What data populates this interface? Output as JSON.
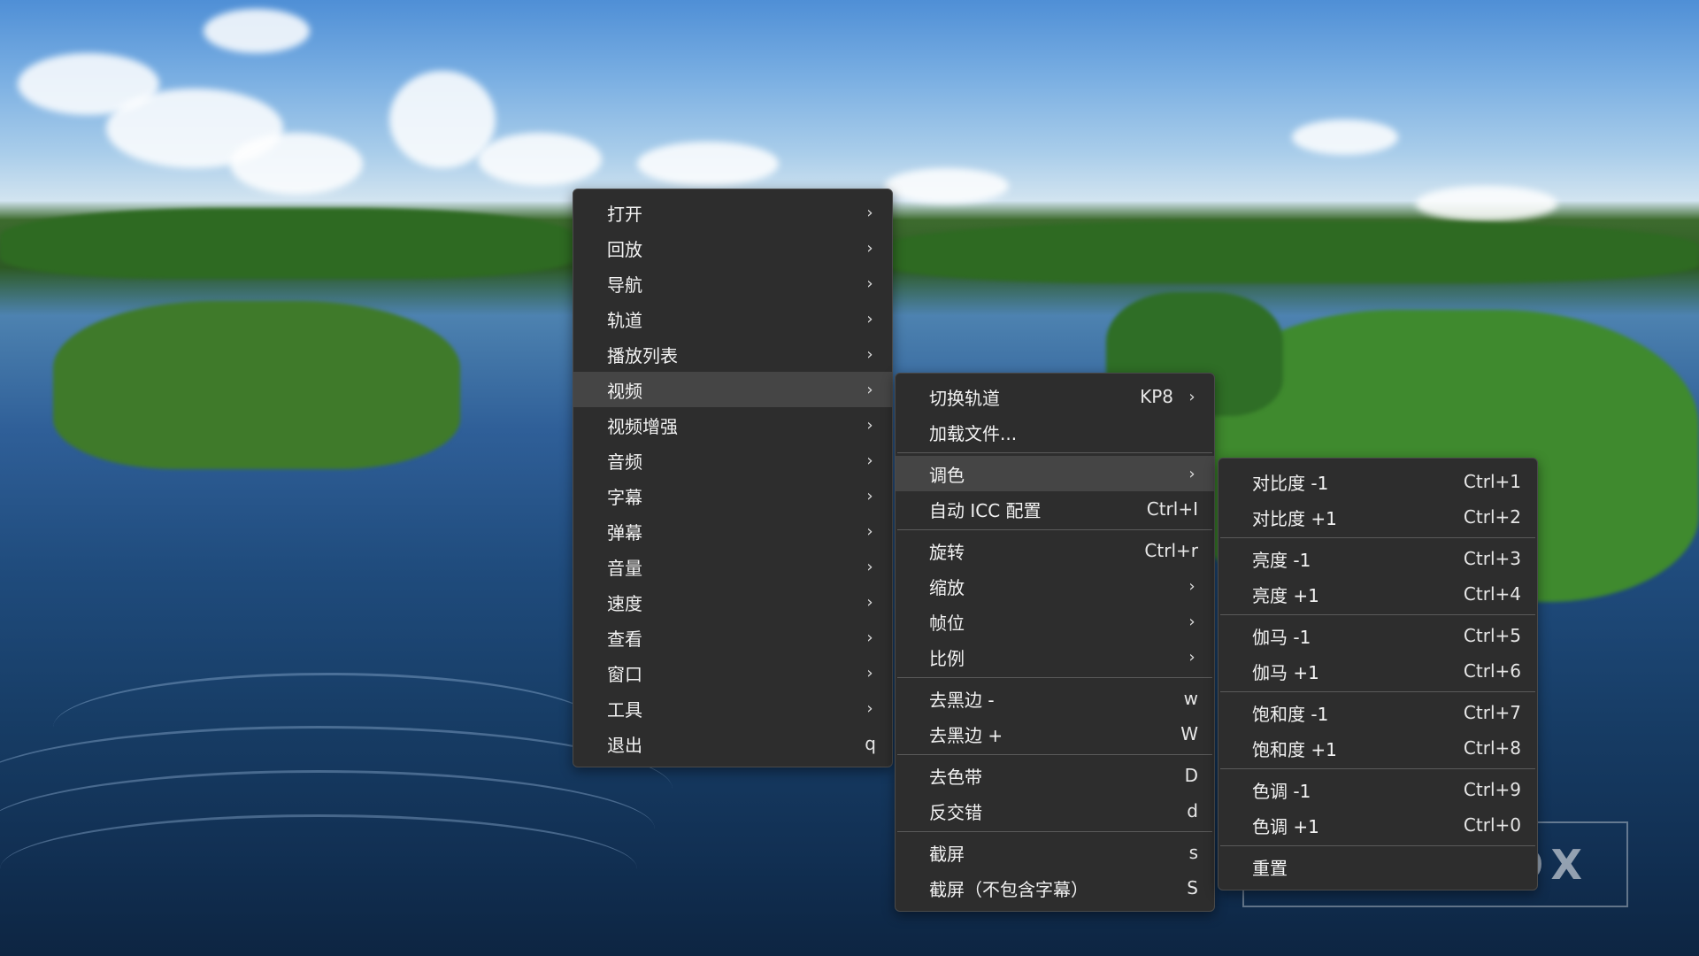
{
  "main_menu": {
    "items": [
      {
        "label": "打开",
        "has_submenu": true
      },
      {
        "label": "回放",
        "has_submenu": true
      },
      {
        "label": "导航",
        "has_submenu": true
      },
      {
        "label": "轨道",
        "has_submenu": true
      },
      {
        "label": "播放列表",
        "has_submenu": true
      },
      {
        "label": "视频",
        "has_submenu": true,
        "active": true
      },
      {
        "label": "视频增强",
        "has_submenu": true
      },
      {
        "label": "音频",
        "has_submenu": true
      },
      {
        "label": "字幕",
        "has_submenu": true
      },
      {
        "label": "弹幕",
        "has_submenu": true
      },
      {
        "label": "音量",
        "has_submenu": true
      },
      {
        "label": "速度",
        "has_submenu": true
      },
      {
        "label": "查看",
        "has_submenu": true
      },
      {
        "label": "窗口",
        "has_submenu": true
      },
      {
        "label": "工具",
        "has_submenu": true
      },
      {
        "label": "退出",
        "shortcut": "q"
      }
    ]
  },
  "video_menu": {
    "items": [
      {
        "label": "切换轨道",
        "shortcut": "KP8",
        "has_submenu": true
      },
      {
        "label": "加载文件..."
      },
      {
        "separator": true
      },
      {
        "label": "调色",
        "has_submenu": true,
        "active": true
      },
      {
        "label": "自动 ICC 配置",
        "shortcut": "Ctrl+I"
      },
      {
        "separator": true
      },
      {
        "label": "旋转",
        "shortcut": "Ctrl+r"
      },
      {
        "label": "缩放",
        "has_submenu": true
      },
      {
        "label": "帧位",
        "has_submenu": true
      },
      {
        "label": "比例",
        "has_submenu": true
      },
      {
        "separator": true
      },
      {
        "label": "去黑边 -",
        "shortcut": "w"
      },
      {
        "label": "去黑边 +",
        "shortcut": "W"
      },
      {
        "separator": true
      },
      {
        "label": "去色带",
        "shortcut": "D"
      },
      {
        "label": "反交错",
        "shortcut": "d"
      },
      {
        "separator": true
      },
      {
        "label": "截屏",
        "shortcut": "s"
      },
      {
        "label": "截屏（不包含字幕）",
        "shortcut": "S"
      }
    ]
  },
  "color_menu": {
    "items": [
      {
        "label": "对比度 -1",
        "shortcut": "Ctrl+1"
      },
      {
        "label": "对比度 +1",
        "shortcut": "Ctrl+2"
      },
      {
        "separator": true
      },
      {
        "label": "亮度 -1",
        "shortcut": "Ctrl+3"
      },
      {
        "label": "亮度 +1",
        "shortcut": "Ctrl+4"
      },
      {
        "separator": true
      },
      {
        "label": "伽马 -1",
        "shortcut": "Ctrl+5"
      },
      {
        "label": "伽马 +1",
        "shortcut": "Ctrl+6"
      },
      {
        "separator": true
      },
      {
        "label": "饱和度 -1",
        "shortcut": "Ctrl+7"
      },
      {
        "label": "饱和度 +1",
        "shortcut": "Ctrl+8"
      },
      {
        "separator": true
      },
      {
        "label": "色调 -1",
        "shortcut": "Ctrl+9"
      },
      {
        "label": "色调 +1",
        "shortcut": "Ctrl+0"
      },
      {
        "separator": true
      },
      {
        "label": "重置"
      }
    ]
  },
  "watermark": {
    "text": "OX"
  },
  "icons": {
    "submenu_arrow": "›"
  },
  "colors": {
    "menu_bg": "#2d2d2d",
    "menu_active": "#454545",
    "menu_text": "#f2f2f2",
    "separator": "#5a5a5a"
  }
}
